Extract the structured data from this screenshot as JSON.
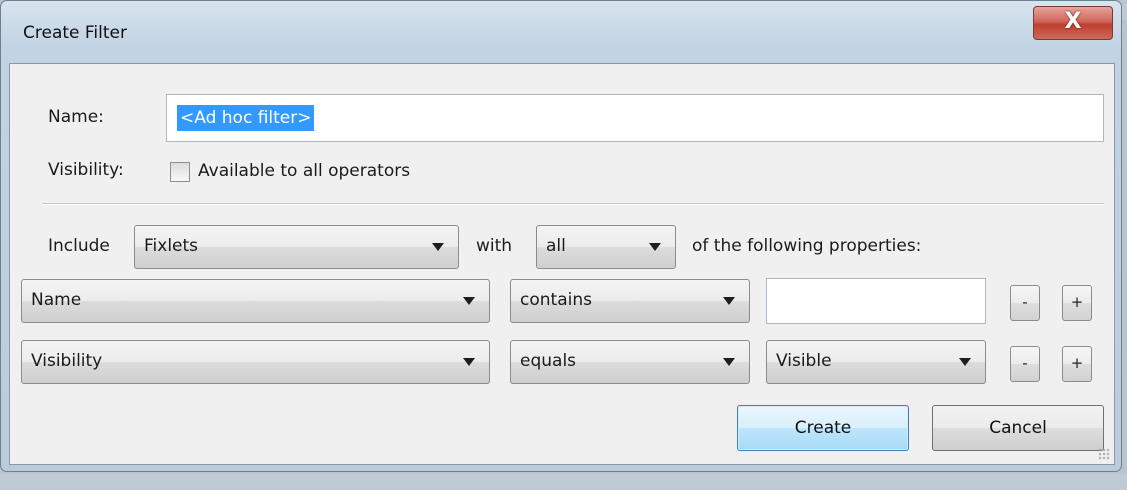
{
  "dialog": {
    "title": "Create Filter",
    "close_label": "X"
  },
  "name_field": {
    "label": "Name:",
    "value": "<Ad hoc filter>"
  },
  "visibility": {
    "label": "Visibility:",
    "checkbox_label": "Available to all operators",
    "checked": false
  },
  "include_row": {
    "label": "Include",
    "type_selected": "Fixlets",
    "with_label": "with",
    "match_selected": "all",
    "suffix": "of the following properties:"
  },
  "conditions": [
    {
      "property": "Name",
      "operator": "contains",
      "value": "",
      "value_kind": "text"
    },
    {
      "property": "Visibility",
      "operator": "equals",
      "value": "Visible",
      "value_kind": "select"
    }
  ],
  "row_buttons": {
    "remove_label": "-",
    "add_label": "+"
  },
  "buttons": {
    "create": "Create",
    "cancel": "Cancel"
  },
  "colors": {
    "selection": "#3399ff",
    "close_button": "#c9483a",
    "default_button_border": "#3c7fb1"
  }
}
